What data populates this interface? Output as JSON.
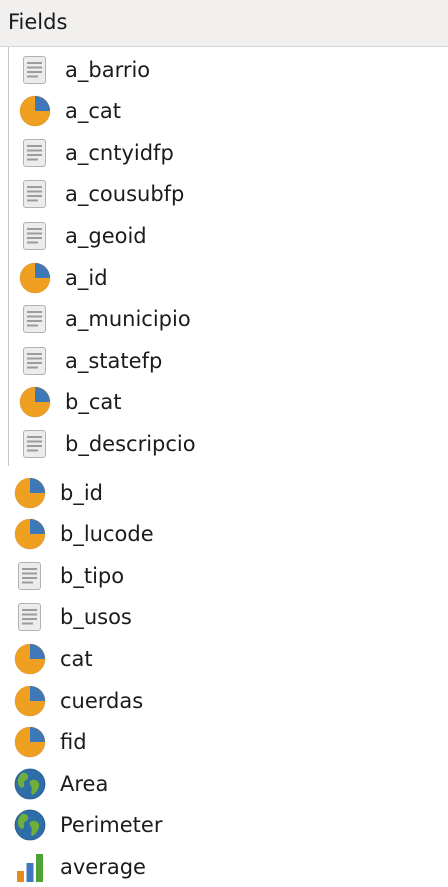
{
  "panel": {
    "title": "Fields"
  },
  "fields_top": [
    {
      "name": "a_barrio",
      "icon": "text-field-icon"
    },
    {
      "name": "a_cat",
      "icon": "numeric-field-icon"
    },
    {
      "name": "a_cntyidfp",
      "icon": "text-field-icon"
    },
    {
      "name": "a_cousubfp",
      "icon": "text-field-icon"
    },
    {
      "name": "a_geoid",
      "icon": "text-field-icon"
    },
    {
      "name": "a_id",
      "icon": "numeric-field-icon"
    },
    {
      "name": "a_municipio",
      "icon": "text-field-icon"
    },
    {
      "name": "a_statefp",
      "icon": "text-field-icon"
    },
    {
      "name": "b_cat",
      "icon": "numeric-field-icon"
    },
    {
      "name": "b_descripcio",
      "icon": "text-field-icon"
    }
  ],
  "fields_bottom": [
    {
      "name": "b_id",
      "icon": "numeric-field-icon"
    },
    {
      "name": "b_lucode",
      "icon": "numeric-field-icon"
    },
    {
      "name": "b_tipo",
      "icon": "text-field-icon"
    },
    {
      "name": "b_usos",
      "icon": "text-field-icon"
    },
    {
      "name": "cat",
      "icon": "numeric-field-icon"
    },
    {
      "name": "cuerdas",
      "icon": "numeric-field-icon"
    },
    {
      "name": "fid",
      "icon": "numeric-field-icon"
    },
    {
      "name": "Area",
      "icon": "geometry-field-icon"
    },
    {
      "name": "Perimeter",
      "icon": "geometry-field-icon"
    },
    {
      "name": "average",
      "icon": "aggregate-field-icon"
    }
  ],
  "colors": {
    "numeric_blue": "#3f78b8",
    "numeric_orange": "#f0a020",
    "globe_ocean": "#2e6ea8",
    "globe_land": "#6fae3a",
    "bar_green": "#4da335",
    "bar_blue": "#3d77c0",
    "bar_orange": "#e88a1c"
  }
}
